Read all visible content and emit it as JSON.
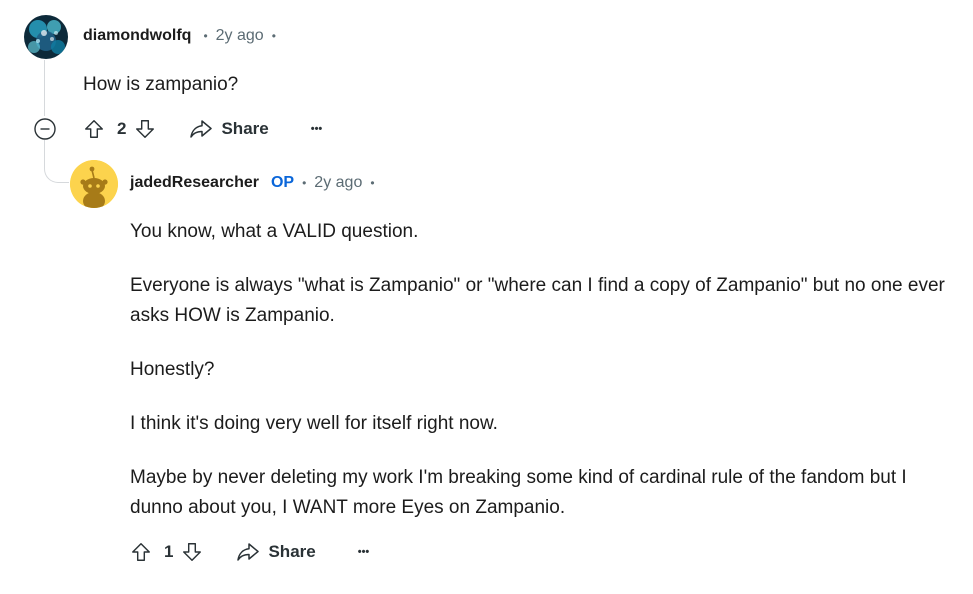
{
  "comment1": {
    "username": "diamondwolfq",
    "separator": "•",
    "time": "2y ago",
    "trailing_dot": "•",
    "body": "How is zampanio?",
    "vote_count": "2",
    "share_label": "Share",
    "more_label": "•••"
  },
  "comment2": {
    "username": "jadedResearcher",
    "op_label": "OP",
    "separator": "•",
    "time": "2y ago",
    "trailing_dot": "•",
    "paragraphs": [
      "You know, what a VALID question.",
      "Everyone is always \"what is Zampanio\" or \"where can I find a copy of Zampanio\" but no one ever asks HOW is Zampanio.",
      "Honestly?",
      "I think it's doing very well for itself right now.",
      "Maybe by never deleting my work I'm breaking some kind of cardinal rule of the fandom but I dunno about you, I WANT more Eyes on Zampanio."
    ],
    "vote_count": "1",
    "share_label": "Share",
    "more_label": "•••"
  },
  "icons": {
    "collapse": "minus-circle-icon",
    "upvote": "arrow-up-icon",
    "downvote": "arrow-down-icon",
    "share": "share-arrow-icon",
    "more": "ellipsis-icon"
  },
  "colors": {
    "op_blue": "#0a66d9",
    "meta_gray": "#5c6c74",
    "thread_line": "#d6d9dc"
  }
}
